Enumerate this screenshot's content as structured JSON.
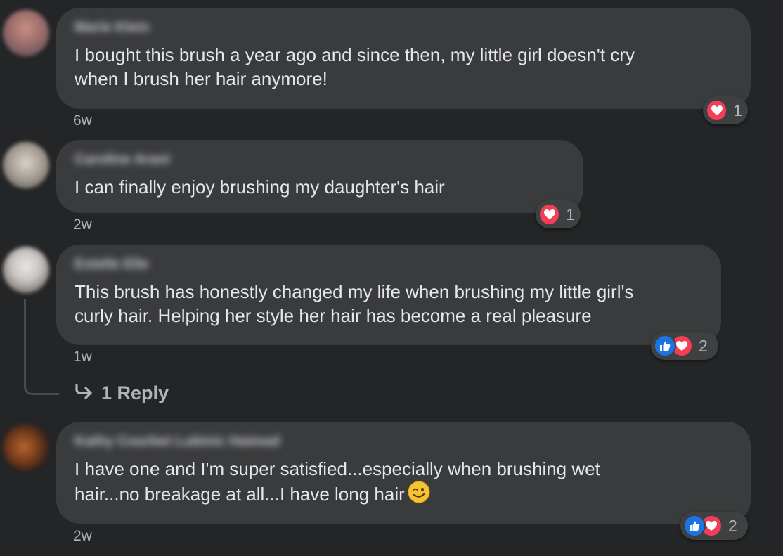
{
  "comments": [
    {
      "author": "Marie Klein",
      "text": "I bought this brush a year ago and since then, my little girl doesn't cry\nwhen I brush her hair anymore!",
      "time": "6w",
      "reactions": [
        "love"
      ],
      "reaction_count": "1"
    },
    {
      "author": "Caroline Arani",
      "text": "I can finally enjoy brushing my daughter's hair",
      "time": "2w",
      "reactions": [
        "love"
      ],
      "reaction_count": "1"
    },
    {
      "author": "Estelle Elle",
      "text": "This brush has honestly changed my life when brushing my little girl's\ncurly hair. Helping her style her hair has become a real pleasure",
      "time": "1w",
      "reactions": [
        "like",
        "love"
      ],
      "reaction_count": "2",
      "replies_label": "1 Reply"
    },
    {
      "author": "Kathy Courbet Lubinic Haimad",
      "text": "I have one and I'm super satisfied...especially when brushing wet\nhair...no breakage at all...I have long hair",
      "emoji": "winking-face",
      "time": "2w",
      "reactions": [
        "like",
        "love"
      ],
      "reaction_count": "2"
    }
  ],
  "colors": {
    "background": "#242526",
    "bubble": "#3a3b3c",
    "like": "#1b74e4",
    "love": "#f33e58",
    "secondary_text": "#b0b3b8"
  },
  "icons": {
    "reply_arrow": "reply-arrow-icon",
    "like": "thumbs-up-icon",
    "love": "heart-icon"
  }
}
